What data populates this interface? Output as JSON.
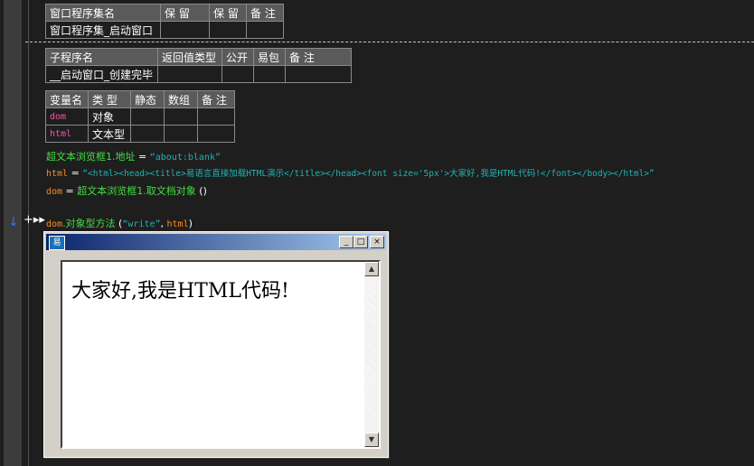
{
  "window_table": {
    "headers": [
      "窗口程序集名",
      "保 留",
      "保 留",
      "备 注"
    ],
    "row": [
      "窗口程序集_启动窗口",
      "",
      "",
      ""
    ]
  },
  "sub_table": {
    "headers": [
      "子程序名",
      "返回值类型",
      "公开",
      "易包",
      "备 注"
    ],
    "row": [
      "__启动窗口_创建完毕",
      "",
      "",
      "",
      ""
    ]
  },
  "var_table": {
    "headers": [
      "变量名",
      "类 型",
      "静态",
      "数组",
      "备 注"
    ],
    "rows": [
      {
        "name": "dom",
        "type": "对象"
      },
      {
        "name": "html",
        "type": "文本型"
      }
    ]
  },
  "code": {
    "line1": {
      "obj": "超文本浏览框1",
      "prop": ".地址",
      "eq": " = ",
      "value": "“about:blank”"
    },
    "line2": {
      "var": "html",
      "eq": " = ",
      "value": "“<html><head><title>易语言直接加载HTML演示</title></head><font size='5px'>大家好,我是HTML代码!</font></body></html>”"
    },
    "line3": {
      "var": "dom",
      "eq": " = ",
      "call": "超文本浏览框1.取文档对象",
      "args": " ()"
    },
    "line4": {
      "var": "dom",
      "method": ".对象型方法",
      "open": " (",
      "arg1": "“write”",
      "comma": ", ",
      "arg2": "html",
      "close": ")"
    }
  },
  "gutter": {
    "arrow": "↓",
    "plus": "+▸▸"
  },
  "preview": {
    "icon": "易",
    "content": "大家好,我是HTML代码!",
    "minimize": "_",
    "maximize": "□",
    "close": "×"
  },
  "colors": {
    "background": "#1e1e1e",
    "identifier": "#44dd44",
    "variable": "#ff8c1a",
    "string": "#22b2b2",
    "varname": "#ff4fb0",
    "titlebar": "#0a246a"
  }
}
